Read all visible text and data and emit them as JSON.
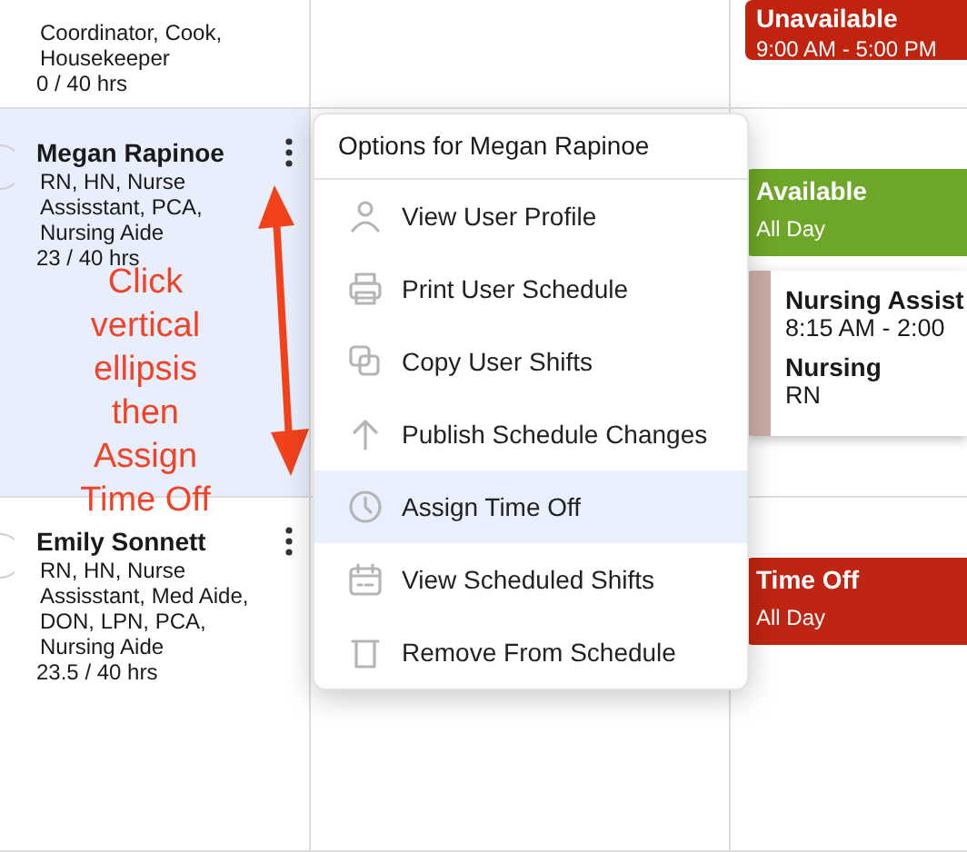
{
  "staff": [
    {
      "roles": "Coordinator, Cook, Housekeeper",
      "hours": "0 / 40 hrs",
      "selected": false
    },
    {
      "name": "Megan Rapinoe",
      "roles": "RN, HN, Nurse Assisstant, PCA, Nursing Aide",
      "hours": "23 / 40 hrs",
      "selected": true,
      "more_button": true,
      "avatar": true
    },
    {
      "name": "Emily Sonnett",
      "roles": "RN, HN, Nurse Assisstant, Med Aide, DON, LPN, PCA, Nursing Aide",
      "hours": "23.5 / 40 hrs",
      "selected": false,
      "more_button": true,
      "avatar": true
    }
  ],
  "day_events": [
    [
      {
        "kind": "status",
        "title": "Unavailable",
        "time": "9:00 AM - 5:00 PM",
        "color": "#c0240f"
      }
    ],
    [
      {
        "kind": "status",
        "title": "Available",
        "time": "All Day",
        "color": "#6da727"
      },
      {
        "kind": "shift",
        "title": "Nursing Assist",
        "time": "8:15 AM - 2:00",
        "department": "Nursing",
        "role": "RN",
        "color": "#c9aea6"
      }
    ],
    [
      {
        "kind": "status",
        "title": "Time Off",
        "time": "All Day",
        "color": "#bf2512"
      }
    ]
  ],
  "menu": {
    "title": "Options for Megan Rapinoe",
    "items": [
      {
        "label": "View User Profile",
        "selected": false
      },
      {
        "label": "Print User Schedule",
        "selected": false
      },
      {
        "label": "Copy User Shifts",
        "selected": false
      },
      {
        "label": "Publish Schedule Changes",
        "selected": false
      },
      {
        "label": "Assign Time Off",
        "selected": true
      },
      {
        "label": "View Scheduled Shifts",
        "selected": false
      },
      {
        "label": "Remove From Schedule",
        "selected": false
      }
    ]
  },
  "annotation": {
    "text": "Click vertical ellipsis then Assign Time Off"
  }
}
